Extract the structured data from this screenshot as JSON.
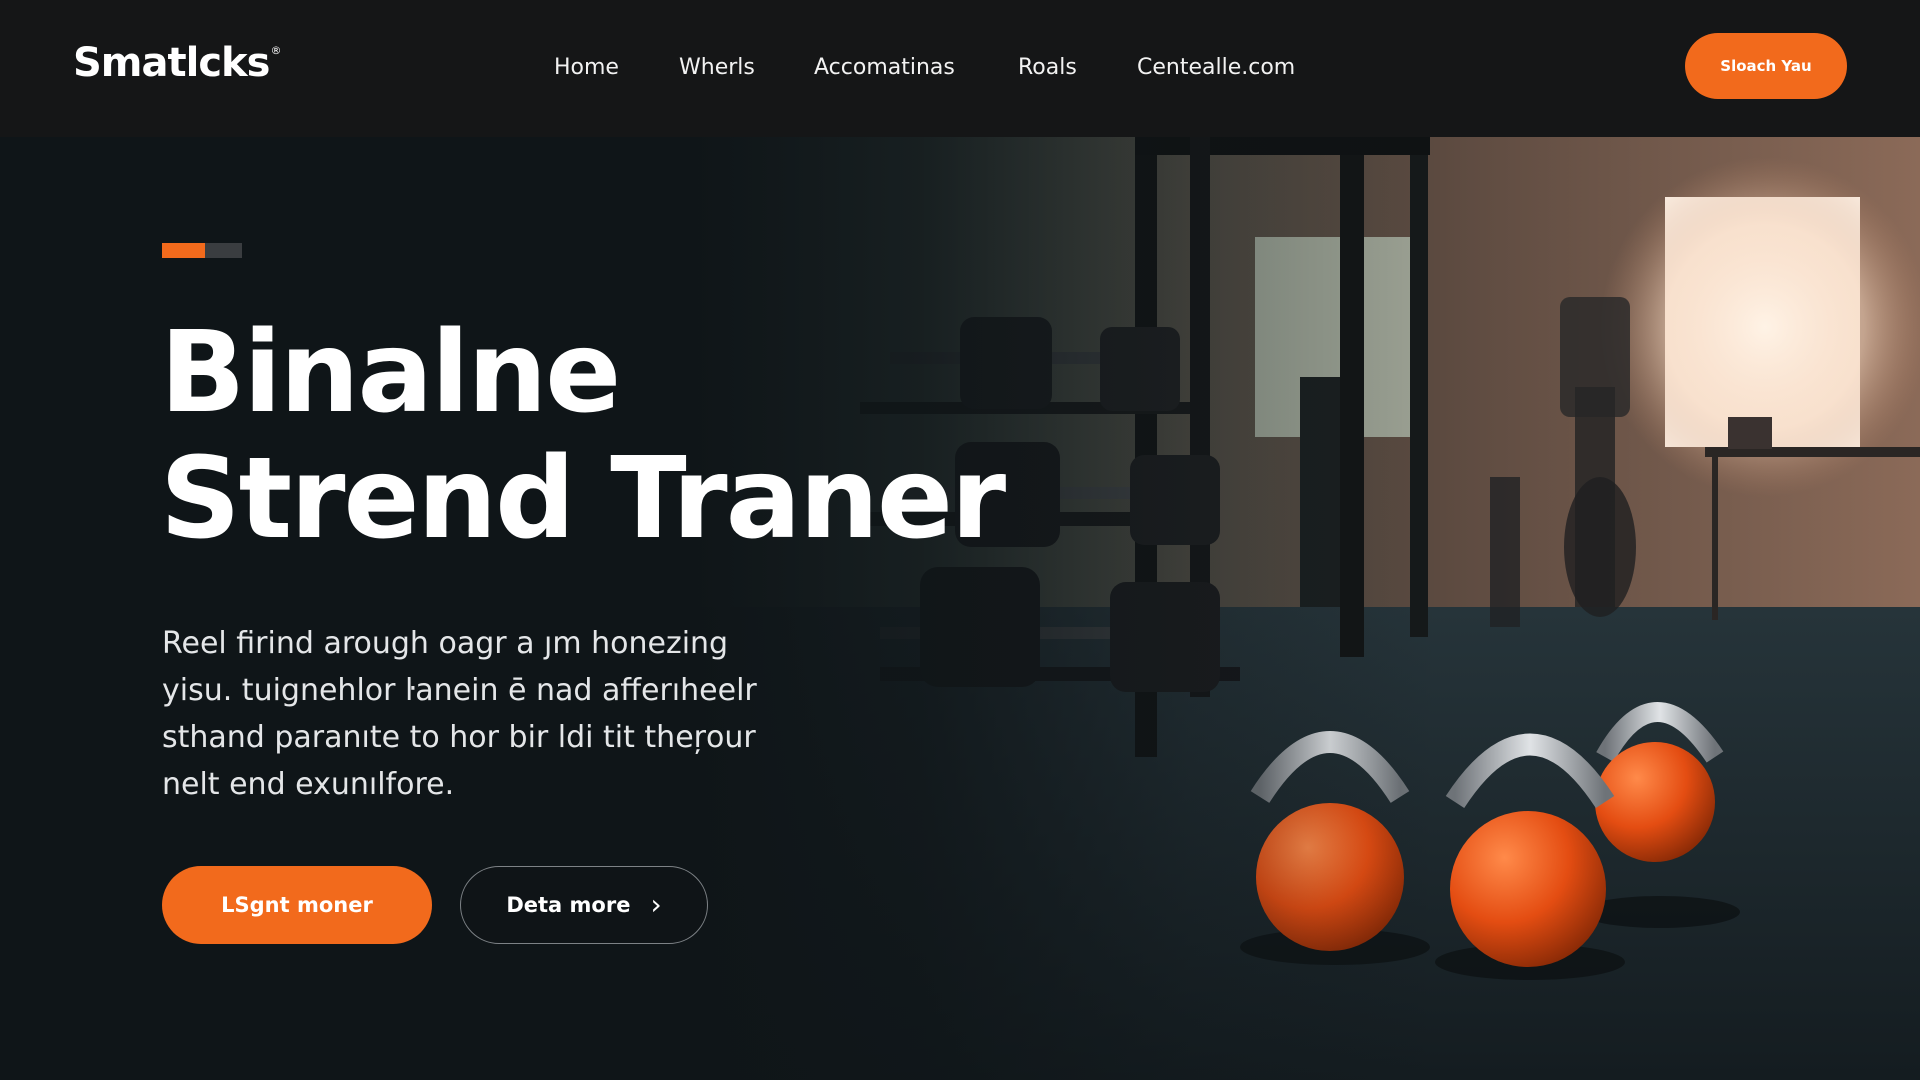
{
  "brand": {
    "name": "Smatlcks",
    "mark": "®"
  },
  "nav": {
    "items": [
      {
        "label": "Home"
      },
      {
        "label": "Wherls"
      },
      {
        "label": "Accomatinas"
      },
      {
        "label": "Roals"
      },
      {
        "label": "Centealle.com"
      }
    ],
    "cta_label": "Sloach Yau"
  },
  "hero": {
    "headline_line1": "Binalne",
    "headline_line2": "Strend Traner",
    "body_lines": [
      "Reel firind arough oagr a ȷm honezing",
      "yisu. tuignehlor ŀanein ē nad afferıheelr",
      "sthand paranıte to hor bir ldi tit theŗour",
      "nelt end exunılfore."
    ],
    "primary_button": "LSgnt moner",
    "secondary_button": "Deta more",
    "secondary_icon": "chevron-right-icon"
  },
  "colors": {
    "accent": "#f26a1c",
    "background": "#101619",
    "header": "#151617"
  }
}
